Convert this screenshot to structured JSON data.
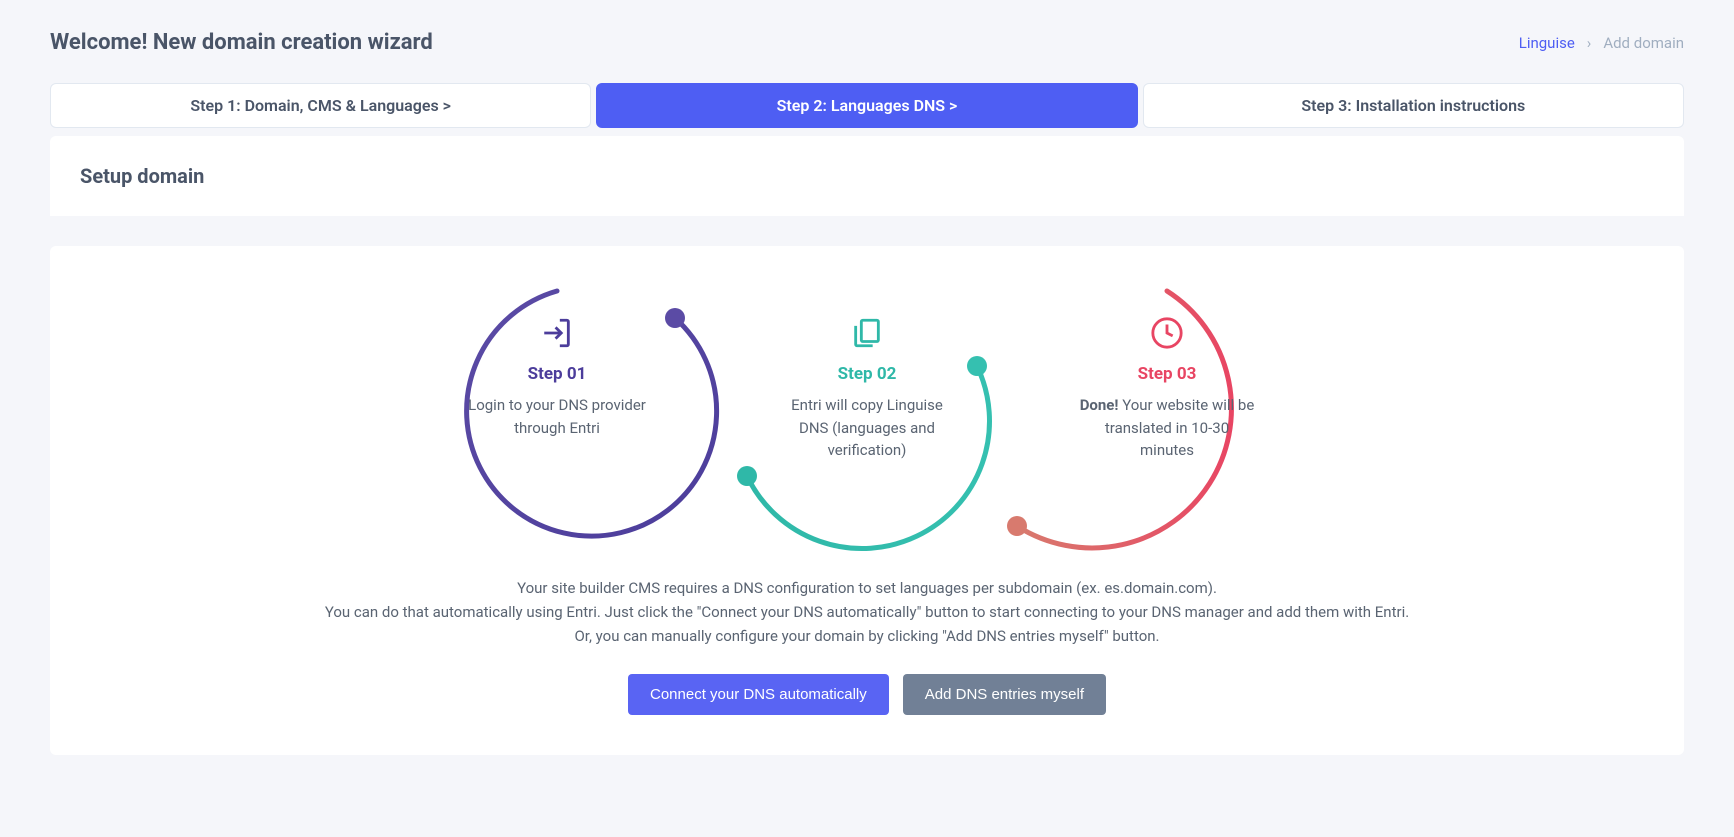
{
  "header": {
    "title": "Welcome! New domain creation wizard",
    "breadcrumb": {
      "root": "Linguise",
      "current": "Add domain"
    }
  },
  "wizard_steps": [
    {
      "label": "Step 1: Domain, CMS & Languages  >",
      "active": false
    },
    {
      "label": "Step 2: Languages DNS  >",
      "active": true
    },
    {
      "label": "Step 3: Installation instructions",
      "active": false
    }
  ],
  "section_title": "Setup domain",
  "diagram_steps": [
    {
      "label": "Step 01",
      "desc": "Login to your DNS provider through Entri"
    },
    {
      "label": "Step 02",
      "desc": "Entri will copy Linguise DNS (languages and verification)"
    },
    {
      "label": "Step 03",
      "desc_bold": "Done!",
      "desc_rest": " Your website will be translated in 10-30 minutes"
    }
  ],
  "info": {
    "line1": "Your site builder CMS requires a DNS configuration to set languages per subdomain (ex. es.domain.com).",
    "line2": "You can do that automatically using Entri. Just click the \"Connect your DNS automatically\" button to start connecting to your DNS manager and add them with Entri.",
    "line3": "Or, you can manually configure your domain by clicking \"Add DNS entries myself\" button."
  },
  "buttons": {
    "connect": "Connect your DNS automatically",
    "manual": "Add DNS entries myself"
  }
}
